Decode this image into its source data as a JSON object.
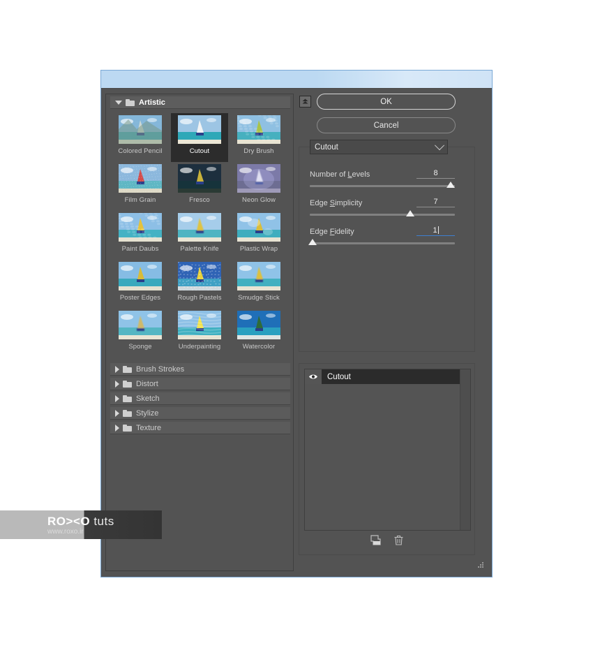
{
  "dialog": {
    "title": "",
    "collapse_icon": "double-chevron-up-icon",
    "ok_label": "OK",
    "cancel_label": "Cancel"
  },
  "browser": {
    "open_category": {
      "label": "Artistic",
      "expanded": true,
      "filters": [
        {
          "label": "Colored Pencil",
          "selected": false
        },
        {
          "label": "Cutout",
          "selected": true
        },
        {
          "label": "Dry Brush",
          "selected": false
        },
        {
          "label": "Film Grain",
          "selected": false
        },
        {
          "label": "Fresco",
          "selected": false
        },
        {
          "label": "Neon Glow",
          "selected": false
        },
        {
          "label": "Paint Daubs",
          "selected": false
        },
        {
          "label": "Palette Knife",
          "selected": false
        },
        {
          "label": "Plastic Wrap",
          "selected": false
        },
        {
          "label": "Poster Edges",
          "selected": false
        },
        {
          "label": "Rough Pastels",
          "selected": false
        },
        {
          "label": "Smudge Stick",
          "selected": false
        },
        {
          "label": "Sponge",
          "selected": false
        },
        {
          "label": "Underpainting",
          "selected": false
        },
        {
          "label": "Watercolor",
          "selected": false
        }
      ]
    },
    "collapsed_categories": [
      {
        "label": "Brush Strokes"
      },
      {
        "label": "Distort"
      },
      {
        "label": "Sketch"
      },
      {
        "label": "Stylize"
      },
      {
        "label": "Texture"
      }
    ]
  },
  "settings": {
    "filter_name": "Cutout",
    "dropdown_icon": "chevron-down-icon",
    "sliders": [
      {
        "label_before": "Number of ",
        "label_key": "L",
        "label_after": "evels",
        "value": "8",
        "min": 2,
        "max": 8,
        "percent": 97,
        "active": false
      },
      {
        "label_before": "Edge ",
        "label_key": "S",
        "label_after": "implicity",
        "value": "7",
        "min": 0,
        "max": 10,
        "percent": 69,
        "active": false
      },
      {
        "label_before": "Edge ",
        "label_key": "F",
        "label_after": "idelity",
        "value": "1",
        "min": 1,
        "max": 3,
        "percent": 2,
        "active": true
      }
    ]
  },
  "layers": {
    "rows": [
      {
        "name": "Cutout",
        "visible": true,
        "visibility_icon": "eye-icon"
      }
    ],
    "tools": [
      {
        "name": "new-effect-layer-icon"
      },
      {
        "name": "delete-effect-layer-icon"
      }
    ]
  },
  "watermark": {
    "brand": "RO><O",
    "suffix": " tuts",
    "url": "www.roxo.ir"
  },
  "colors": {
    "panel_bg": "#535353",
    "panel_dark": "#4a4a4a",
    "selection": "#2b2b2b",
    "titlebar": "#bcd9f2",
    "accent": "#3d7fd0",
    "frame": "#7aa9d6"
  }
}
